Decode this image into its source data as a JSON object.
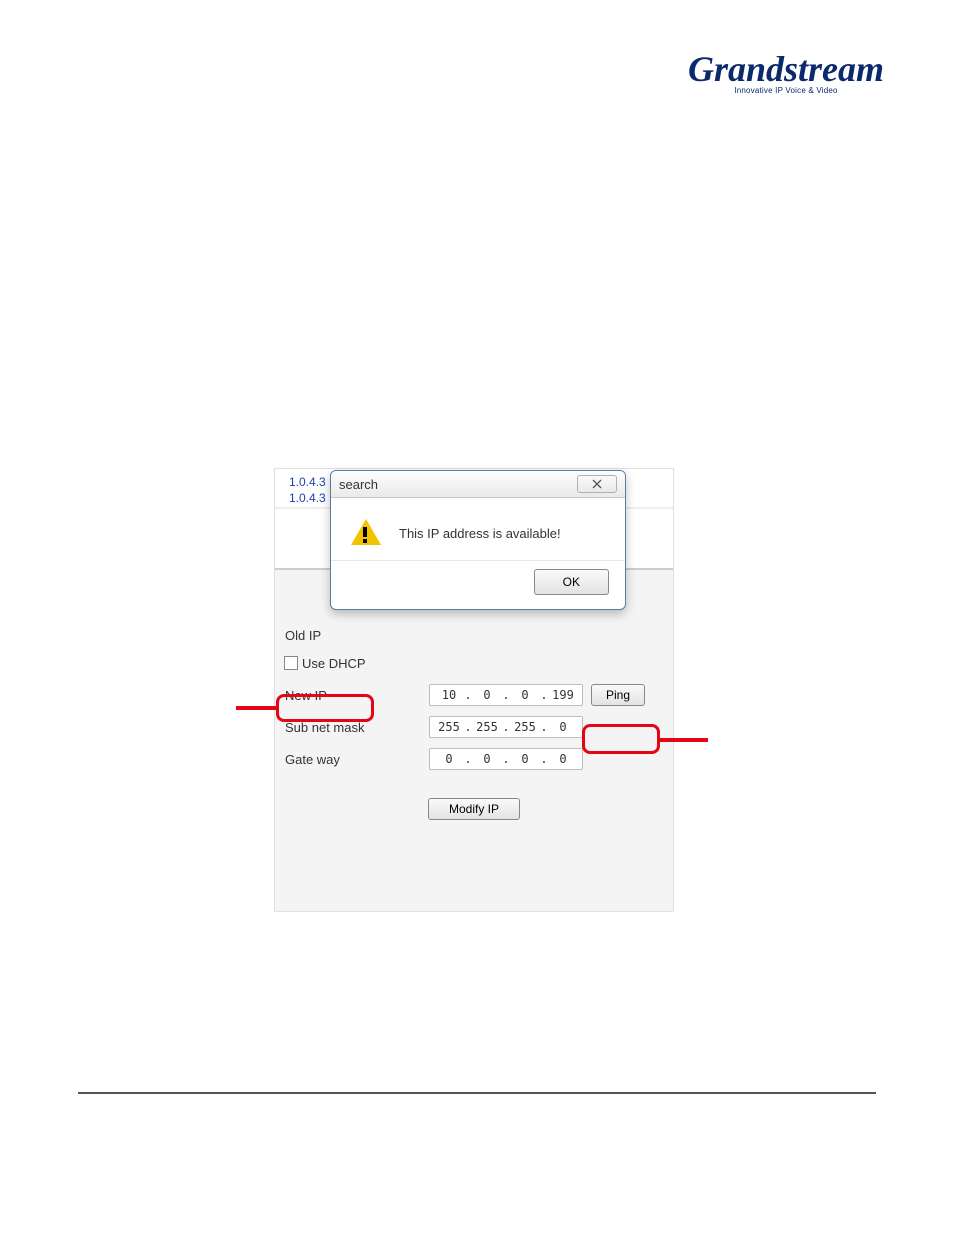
{
  "logo": {
    "name": "Grandstream",
    "tagline": "Innovative IP Voice & Video"
  },
  "panel": {
    "versions": [
      "1.0.4.3",
      "1.0.4.3"
    ],
    "labels": {
      "old_ip": "Old IP",
      "use_dhcp": "Use DHCP",
      "new_ip": "New IP",
      "subnet": "Sub net mask",
      "gateway": "Gate way"
    },
    "new_ip": {
      "a": "10",
      "b": "0",
      "c": "0",
      "d": "199"
    },
    "subnet": {
      "a": "255",
      "b": "255",
      "c": "255",
      "d": "0"
    },
    "gateway": {
      "a": "0",
      "b": "0",
      "c": "0",
      "d": "0"
    },
    "buttons": {
      "ping": "Ping",
      "modify": "Modify IP"
    }
  },
  "dialog": {
    "title": "search",
    "message": "This IP address is available!",
    "ok": "OK"
  }
}
